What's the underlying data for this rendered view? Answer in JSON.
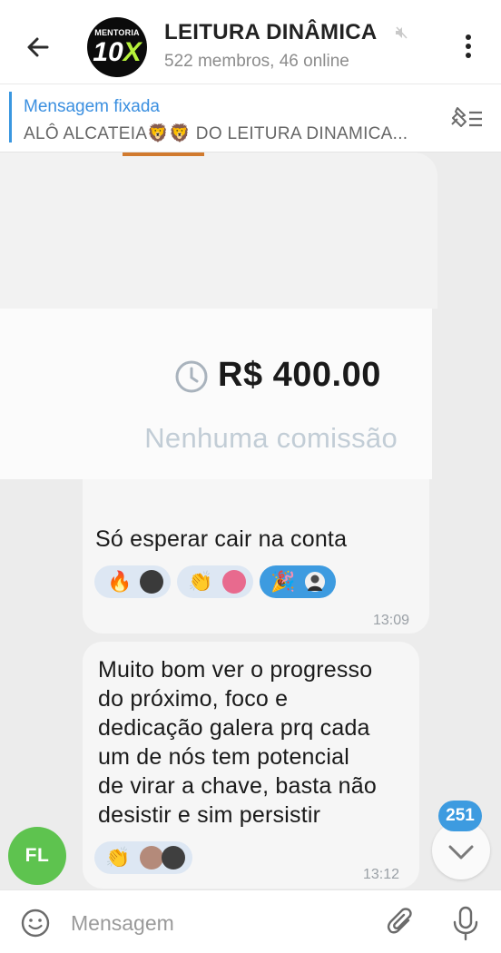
{
  "header": {
    "title": "LEITURA DINÂMICA",
    "subtitle": "522 membros, 46 online",
    "avatar": {
      "top_text": "MENTORIA",
      "big_text": "10",
      "big_accent": "X"
    },
    "icons": [
      "arrow-left-icon",
      "mute-icon",
      "more-vertical-icon"
    ]
  },
  "pinned": {
    "label": "Mensagem fixada",
    "text": "ALÔ ALCATEIA🦁🦁 DO LEITURA DINAMICA..."
  },
  "card": {
    "amount": "R$ 400.00",
    "commission": "Nenhuma comissão"
  },
  "messages": [
    {
      "text": "Só esperar cair na conta",
      "time": "13:09",
      "reactions": [
        {
          "emoji": "🔥"
        },
        {
          "emoji": "👏"
        },
        {
          "emoji": "🎉"
        }
      ]
    },
    {
      "text": "Muito bom ver o progresso\ndo próximo, foco e\ndedicação galera prq cada\num de nós tem potencial\nde virar a chave, basta não\ndesistir e sim persistir",
      "time": "13:12",
      "reactions": [
        {
          "emoji": "👏"
        }
      ]
    }
  ],
  "sender_avatar": {
    "initials": "FL",
    "color": "#5ec34f"
  },
  "unread_count": "251",
  "input": {
    "placeholder": "Mensagem"
  },
  "colors": {
    "accent": "#3d9be0",
    "chat_bg": "#ececec",
    "bubble": "#f6f6f6",
    "reaction_bg": "#dde7f3"
  }
}
